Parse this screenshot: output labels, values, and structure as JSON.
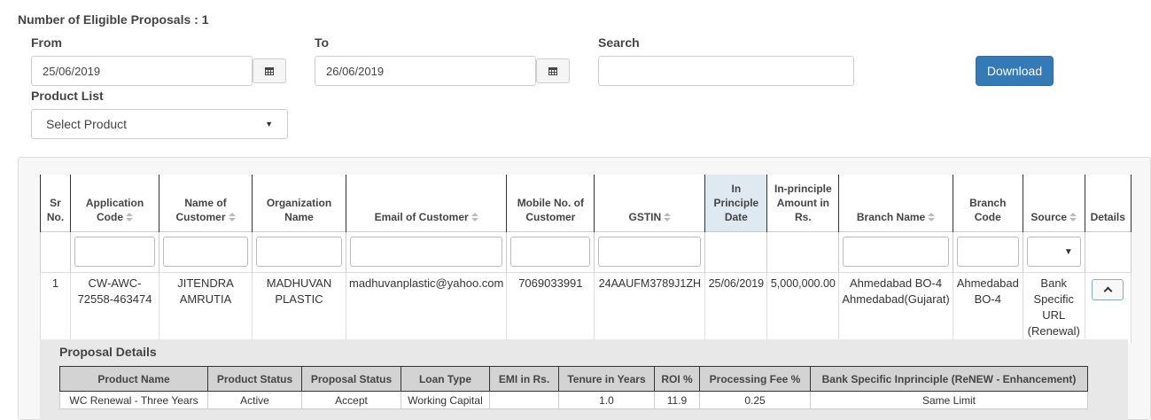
{
  "summary": {
    "label": "Number of Eligible Proposals : 1"
  },
  "filters": {
    "from_label": "From",
    "from_value": "25/06/2019",
    "to_label": "To",
    "to_value": "26/06/2019",
    "search_label": "Search",
    "search_value": "",
    "download_label": "Download",
    "product_list_label": "Product List",
    "product_selected": "Select Product"
  },
  "table": {
    "columns": [
      "Sr No.",
      "Application Code",
      "Name of Customer",
      "Organization Name",
      "Email of Customer",
      "Mobile No. of Customer",
      "GSTIN",
      "In Principle Date",
      "In-principle Amount in Rs.",
      "Branch Name",
      "Branch Code",
      "Source",
      "Details"
    ],
    "rows": [
      {
        "sr": "1",
        "application_code": "CW-AWC-72558-463474",
        "customer_name": "JITENDRA AMRUTIA",
        "organization": "MADHUVAN PLASTIC",
        "email": "madhuvanplastic@yahoo.com",
        "mobile": "7069033991",
        "gstin": "24AAUFM3789J1ZH",
        "in_principle_date": "25/06/2019",
        "amount": "5,000,000.00",
        "branch_name": "Ahmedabad BO-4 Ahmedabad(Gujarat)",
        "branch_code": "Ahmedabad BO-4",
        "source": "Bank Specific URL (Renewal)"
      }
    ]
  },
  "proposal_details": {
    "title": "Proposal Details",
    "columns": [
      "Product Name",
      "Product Status",
      "Proposal Status",
      "Loan Type",
      "EMI in Rs.",
      "Tenure in Years",
      "ROI %",
      "Processing Fee %",
      "Bank Specific Inprinciple (ReNEW - Enhancement)"
    ],
    "row": {
      "product_name": "WC Renewal - Three Years",
      "product_status": "Active",
      "proposal_status": "Accept",
      "loan_type": "Working Capital",
      "emi": "",
      "tenure": "1.0",
      "roi": "11.9",
      "processing_fee": "0.25",
      "bank_specific": "Same Limit"
    }
  },
  "colors": {
    "primary_button": "#337ab7",
    "highlight_header": "#dfe9f2"
  }
}
